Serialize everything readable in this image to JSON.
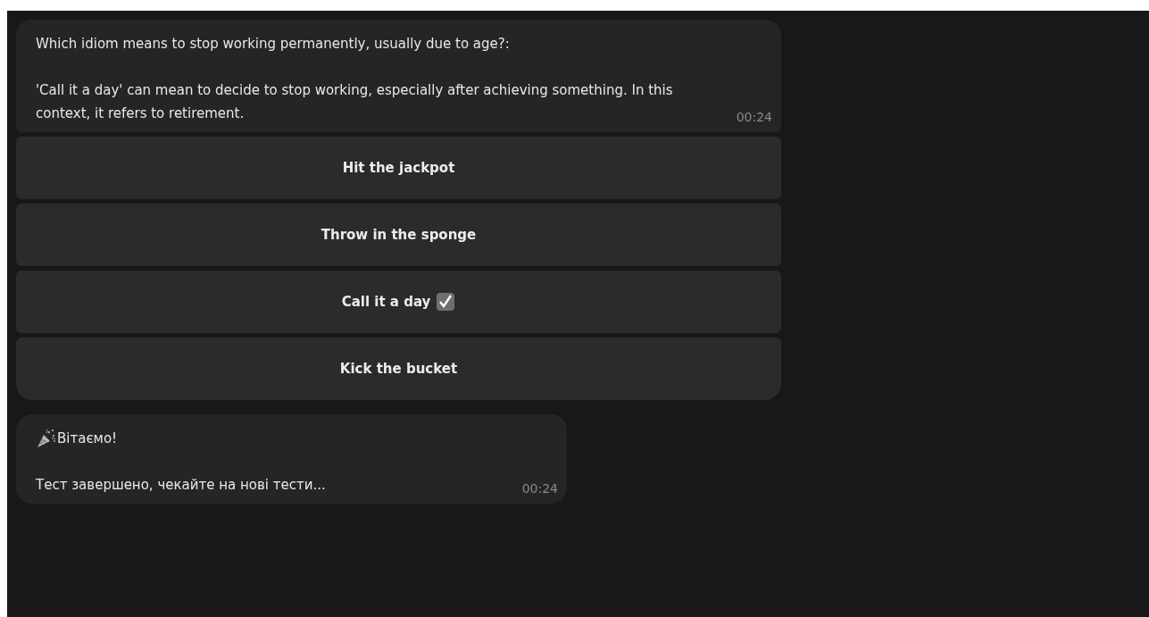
{
  "messages": [
    {
      "kind": "quiz",
      "paragraphs": [
        "Which idiom means to stop working permanently, usually due to age?:",
        "'Call it a day' can mean to decide to stop working, especially after achieving something. In this context, it refers to retirement."
      ],
      "time": "00:24",
      "buttons": [
        {
          "label": "Hit the jackpot",
          "checked": false
        },
        {
          "label": "Throw in the sponge",
          "checked": false
        },
        {
          "label": "Call it a day",
          "checked": true
        },
        {
          "label": "Kick the bucket",
          "checked": false
        }
      ]
    },
    {
      "kind": "congrats",
      "paragraphs": [
        "Вітаємо!",
        "Тест завершено, чекайте на нові тести..."
      ],
      "time": "00:24"
    }
  ]
}
